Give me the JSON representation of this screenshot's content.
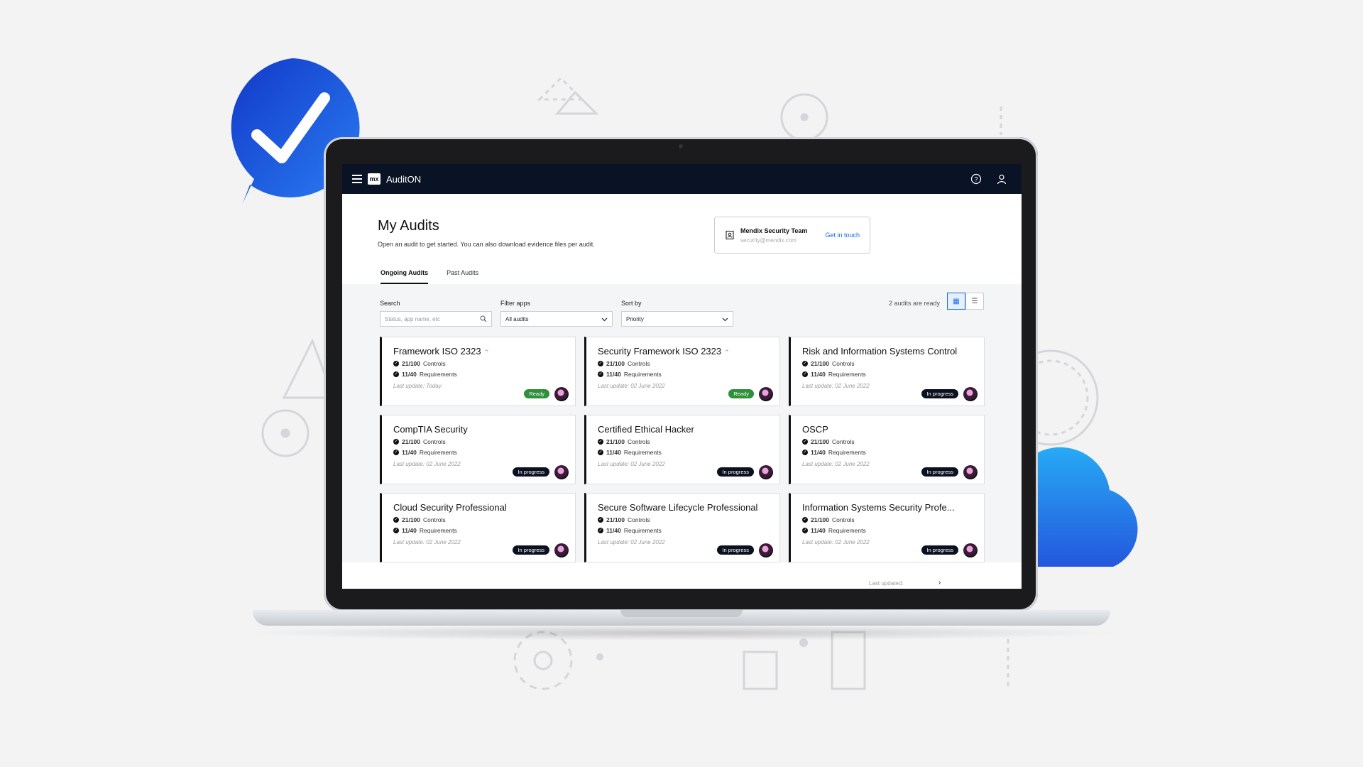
{
  "app": {
    "name": "AuditON",
    "logo_text": "mx"
  },
  "page": {
    "title": "My Audits",
    "subtitle": "Open an audit to get started. You can also download evidence files per audit."
  },
  "contact": {
    "title": "Mendix Security Team",
    "email": "security@mendix.com",
    "link": "Get in touch"
  },
  "tabs": [
    {
      "label": "Ongoing Audits",
      "active": true
    },
    {
      "label": "Past Audits",
      "active": false
    }
  ],
  "filters": {
    "search_label": "Search",
    "search_placeholder": "Status, app name, etc",
    "filter_label": "Filter apps",
    "filter_value": "All audits",
    "sort_label": "Sort by",
    "sort_value": "Priority"
  },
  "ready_count": "2 audits are ready",
  "cards": [
    {
      "title": "Framework ISO 2323",
      "controls": "21/100",
      "controls_label": "Controls",
      "requirements": "11/40",
      "requirements_label": "Requirements",
      "update": "Last update: Today",
      "status": "Ready",
      "priority": true
    },
    {
      "title": "Security Framework ISO 2323",
      "controls": "21/100",
      "controls_label": "Controls",
      "requirements": "11/40",
      "requirements_label": "Requirements",
      "update": "Last update: 02 June 2022",
      "status": "Ready",
      "priority": true
    },
    {
      "title": "Risk and Information Systems Control",
      "controls": "21/100",
      "controls_label": "Controls",
      "requirements": "11/40",
      "requirements_label": "Requirements",
      "update": "Last update: 02 June 2022",
      "status": "In progress",
      "priority": false
    },
    {
      "title": "CompTIA Security",
      "controls": "21/100",
      "controls_label": "Controls",
      "requirements": "11/40",
      "requirements_label": "Requirements",
      "update": "Last update: 02 June 2022",
      "status": "In progress",
      "priority": false
    },
    {
      "title": "Certified Ethical Hacker",
      "controls": "21/100",
      "controls_label": "Controls",
      "requirements": "11/40",
      "requirements_label": "Requirements",
      "update": "Last update: 02 June 2022",
      "status": "In progress",
      "priority": false
    },
    {
      "title": "OSCP",
      "controls": "21/100",
      "controls_label": "Controls",
      "requirements": "11/40",
      "requirements_label": "Requirements",
      "update": "Last update: 02 June 2022",
      "status": "In progress",
      "priority": false
    },
    {
      "title": "Cloud Security Professional",
      "controls": "21/100",
      "controls_label": "Controls",
      "requirements": "11/40",
      "requirements_label": "Requirements",
      "update": "Last update: 02 June 2022",
      "status": "In progress",
      "priority": false
    },
    {
      "title": "Secure Software Lifecycle Professional",
      "controls": "21/100",
      "controls_label": "Controls",
      "requirements": "11/40",
      "requirements_label": "Requirements",
      "update": "Last update: 02 June 2022",
      "status": "In progress",
      "priority": false
    },
    {
      "title": "Information Systems Security Profe...",
      "controls": "21/100",
      "controls_label": "Controls",
      "requirements": "11/40",
      "requirements_label": "Requirements",
      "update": "Last update: 02 June 2022",
      "status": "In progress",
      "priority": false
    }
  ],
  "peek_text": "Last updated:",
  "colors": {
    "topbar": "#0a1325",
    "ready": "#2f8f3a",
    "in_progress": "#0b1120",
    "link": "#1864e6",
    "checkmark_bubble": "#1f58e0",
    "cloud": "#2f7ef0"
  }
}
